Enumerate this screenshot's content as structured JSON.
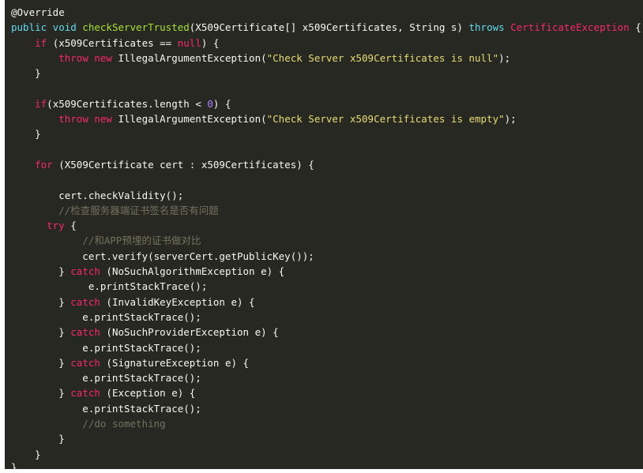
{
  "code": {
    "lines": [
      [
        {
          "t": "@Override",
          "c": "ann"
        }
      ],
      [
        {
          "t": "public void ",
          "c": "kw"
        },
        {
          "t": "checkServerTrusted",
          "c": "fn"
        },
        {
          "t": "(X509Certificate[] x509Certificates, String s) ",
          "c": ""
        },
        {
          "t": "throws",
          "c": "kw"
        },
        {
          "t": " ",
          "c": ""
        },
        {
          "t": "CertificateException",
          "c": "red"
        },
        {
          "t": " {",
          "c": ""
        }
      ],
      [
        {
          "t": "    ",
          "c": ""
        },
        {
          "t": "if",
          "c": "red"
        },
        {
          "t": " (x509Certificates == ",
          "c": ""
        },
        {
          "t": "null",
          "c": "red"
        },
        {
          "t": ") {",
          "c": ""
        }
      ],
      [
        {
          "t": "        ",
          "c": ""
        },
        {
          "t": "throw new",
          "c": "red"
        },
        {
          "t": " IllegalArgumentException(",
          "c": ""
        },
        {
          "t": "\"Check Server x509Certificates is null\"",
          "c": "str"
        },
        {
          "t": ");",
          "c": ""
        }
      ],
      [
        {
          "t": "    }",
          "c": ""
        }
      ],
      [
        {
          "t": "",
          "c": ""
        }
      ],
      [
        {
          "t": "    ",
          "c": ""
        },
        {
          "t": "if",
          "c": "red"
        },
        {
          "t": "(x509Certificates.length < ",
          "c": ""
        },
        {
          "t": "0",
          "c": "num"
        },
        {
          "t": ") {",
          "c": ""
        }
      ],
      [
        {
          "t": "        ",
          "c": ""
        },
        {
          "t": "throw new",
          "c": "red"
        },
        {
          "t": " IllegalArgumentException(",
          "c": ""
        },
        {
          "t": "\"Check Server x509Certificates is empty\"",
          "c": "str"
        },
        {
          "t": ");",
          "c": ""
        }
      ],
      [
        {
          "t": "    }",
          "c": ""
        }
      ],
      [
        {
          "t": "",
          "c": ""
        }
      ],
      [
        {
          "t": "    ",
          "c": ""
        },
        {
          "t": "for",
          "c": "red"
        },
        {
          "t": " (X509Certificate cert : x509Certificates) {",
          "c": ""
        }
      ],
      [
        {
          "t": "",
          "c": ""
        }
      ],
      [
        {
          "t": "        cert.checkValidity();",
          "c": ""
        }
      ],
      [
        {
          "t": "        ",
          "c": ""
        },
        {
          "t": "//检查服务器端证书签名是否有问题",
          "c": "cm"
        }
      ],
      [
        {
          "t": "      ",
          "c": ""
        },
        {
          "t": "try",
          "c": "red"
        },
        {
          "t": " {",
          "c": ""
        }
      ],
      [
        {
          "t": "            ",
          "c": ""
        },
        {
          "t": "//和APP预埋的证书做对比",
          "c": "cm"
        }
      ],
      [
        {
          "t": "            cert.verify(serverCert.getPublicKey());",
          "c": ""
        }
      ],
      [
        {
          "t": "        } ",
          "c": ""
        },
        {
          "t": "catch",
          "c": "red"
        },
        {
          "t": " (NoSuchAlgorithmException e) {",
          "c": ""
        }
      ],
      [
        {
          "t": "             e.printStackTrace();",
          "c": ""
        }
      ],
      [
        {
          "t": "        } ",
          "c": ""
        },
        {
          "t": "catch",
          "c": "red"
        },
        {
          "t": " (InvalidKeyException e) {",
          "c": ""
        }
      ],
      [
        {
          "t": "            e.printStackTrace();",
          "c": ""
        }
      ],
      [
        {
          "t": "        } ",
          "c": ""
        },
        {
          "t": "catch",
          "c": "red"
        },
        {
          "t": " (NoSuchProviderException e) {",
          "c": ""
        }
      ],
      [
        {
          "t": "            e.printStackTrace();",
          "c": ""
        }
      ],
      [
        {
          "t": "        } ",
          "c": ""
        },
        {
          "t": "catch",
          "c": "red"
        },
        {
          "t": " (SignatureException e) {",
          "c": ""
        }
      ],
      [
        {
          "t": "            e.printStackTrace();",
          "c": ""
        }
      ],
      [
        {
          "t": "        } ",
          "c": ""
        },
        {
          "t": "catch",
          "c": "red"
        },
        {
          "t": " (Exception e) {",
          "c": ""
        }
      ],
      [
        {
          "t": "            e.printStackTrace();",
          "c": ""
        }
      ],
      [
        {
          "t": "            ",
          "c": ""
        },
        {
          "t": "//do something",
          "c": "cm"
        }
      ],
      [
        {
          "t": "        }",
          "c": ""
        }
      ],
      [
        {
          "t": "    }",
          "c": ""
        }
      ]
    ],
    "closing_brace": "}"
  },
  "colors": {
    "background": "#272822",
    "plain": "#f8f8f2",
    "keyword": "#66d9ef",
    "control": "#f92672",
    "function": "#a6e22e",
    "number": "#ae81ff",
    "string": "#e6db74",
    "comment": "#75715e"
  }
}
